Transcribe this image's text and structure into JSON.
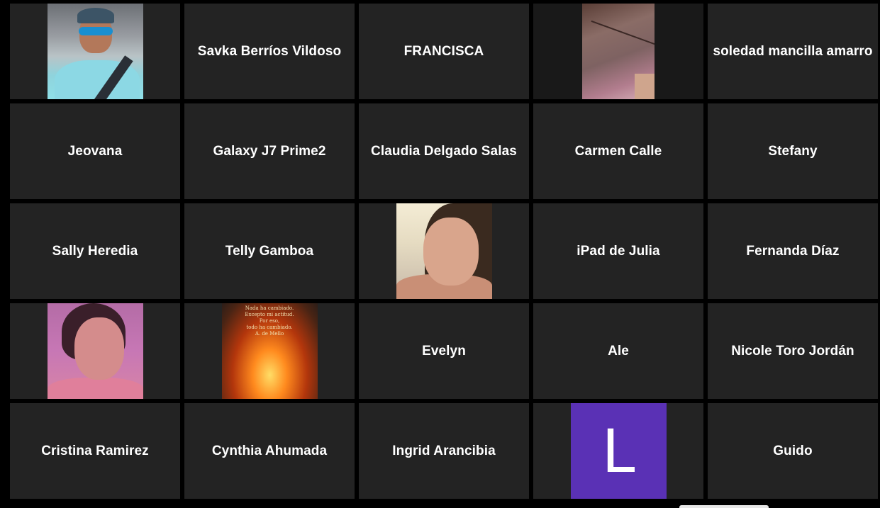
{
  "participants": [
    {
      "name": "",
      "thumbnail": "man-in-car-photo"
    },
    {
      "name": "Savka Berríos Vildoso"
    },
    {
      "name": "FRANCISCA"
    },
    {
      "name": "",
      "thumbnail": "ceiling-photo"
    },
    {
      "name": "soledad mancilla amarro"
    },
    {
      "name": "Jeovana"
    },
    {
      "name": "Galaxy J7 Prime2"
    },
    {
      "name": "Claudia Delgado Salas"
    },
    {
      "name": "Carmen Calle"
    },
    {
      "name": "Stefany"
    },
    {
      "name": "Sally Heredia"
    },
    {
      "name": "Telly Gamboa"
    },
    {
      "name": "",
      "thumbnail": "woman-portrait-photo"
    },
    {
      "name": "iPad de Julia"
    },
    {
      "name": "Fernanda Díaz"
    },
    {
      "name": "",
      "thumbnail": "woman-pink-photo"
    },
    {
      "name": "",
      "thumbnail": "fire-poster-image",
      "poster_text": [
        "Nada ha cambiado.",
        "Excepto mi actitud.",
        "Por eso,",
        "todo ha cambiado.",
        "A. de Mello"
      ]
    },
    {
      "name": "Evelyn"
    },
    {
      "name": "Ale"
    },
    {
      "name": "Nicole Toro Jordán"
    },
    {
      "name": "Cristina Ramirez"
    },
    {
      "name": "Cynthia Ahumada"
    },
    {
      "name": "Ingrid Arancibia"
    },
    {
      "name": "",
      "avatar_letter": "L",
      "avatar_color": "#5a31b5"
    },
    {
      "name": "Guido"
    }
  ],
  "colors": {
    "background": "#000000",
    "tile": "#232323",
    "text": "#ffffff"
  }
}
